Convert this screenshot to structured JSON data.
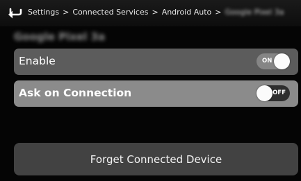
{
  "header": {
    "breadcrumb": {
      "items": [
        "Settings",
        "Connected Services",
        "Android Auto",
        "Google Pixel 3a"
      ],
      "separator": ">"
    },
    "back_icon": "back-arrow-icon"
  },
  "device": {
    "title": "Google Pixel 3a"
  },
  "settings": {
    "enable": {
      "label": "Enable",
      "toggle_text": "ON",
      "state": true
    },
    "ask_on_connection": {
      "label": "Ask on Connection",
      "toggle_text": "OFF",
      "state": false
    }
  },
  "actions": {
    "forget_label": "Forget Connected Device"
  },
  "colors": {
    "background": "#050505",
    "row_default": "#5c5c5c",
    "row_selected": "#8b8b8b",
    "button": "#424242",
    "text": "#ffffff"
  }
}
